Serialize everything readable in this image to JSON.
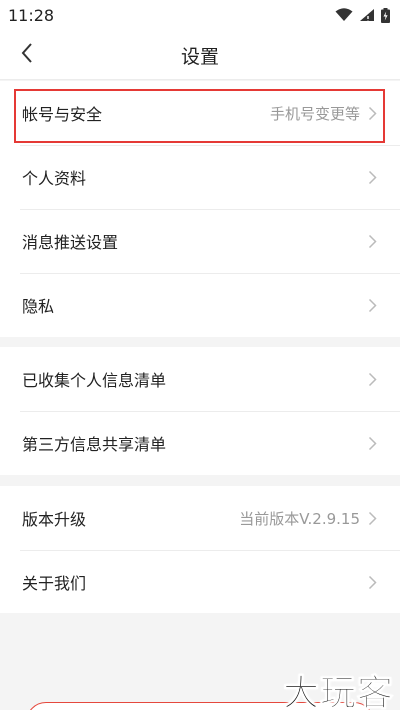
{
  "status_bar": {
    "time": "11:28"
  },
  "header": {
    "title": "设置",
    "back_icon": "chevron-left-icon"
  },
  "groups": [
    {
      "items": [
        {
          "label": "帐号与安全",
          "value": "手机号变更等",
          "highlighted": true
        },
        {
          "label": "个人资料",
          "value": ""
        },
        {
          "label": "消息推送设置",
          "value": ""
        },
        {
          "label": "隐私",
          "value": ""
        }
      ]
    },
    {
      "items": [
        {
          "label": "已收集个人信息清单",
          "value": ""
        },
        {
          "label": "第三方信息共享清单",
          "value": ""
        }
      ]
    },
    {
      "items": [
        {
          "label": "版本升级",
          "value": "当前版本V.2.9.15"
        },
        {
          "label": "关于我们",
          "value": ""
        }
      ]
    }
  ],
  "watermark": "大玩客",
  "colors": {
    "highlight": "#e53935",
    "background": "#f4f4f4",
    "text": "#222222",
    "muted": "#999999"
  }
}
